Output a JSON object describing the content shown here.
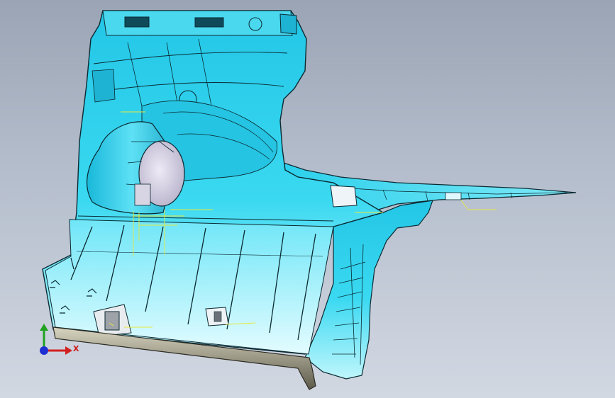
{
  "viewport": {
    "title": "",
    "background_top": "#9aa4b4",
    "background_bottom": "#d2d8e2"
  },
  "model": {
    "part_color": "#33d6f0",
    "part_color_light": "#9ff0fb",
    "edge_color": "#0b2a33",
    "trim_color": "#7a7a6a",
    "boss_color": "#d7d4e4",
    "annotation_color": "#e8e83a"
  },
  "triad": {
    "x_label": "X",
    "x_color": "#d21f1f",
    "y_color": "#21a121",
    "z_color": "#1f2fd2"
  }
}
